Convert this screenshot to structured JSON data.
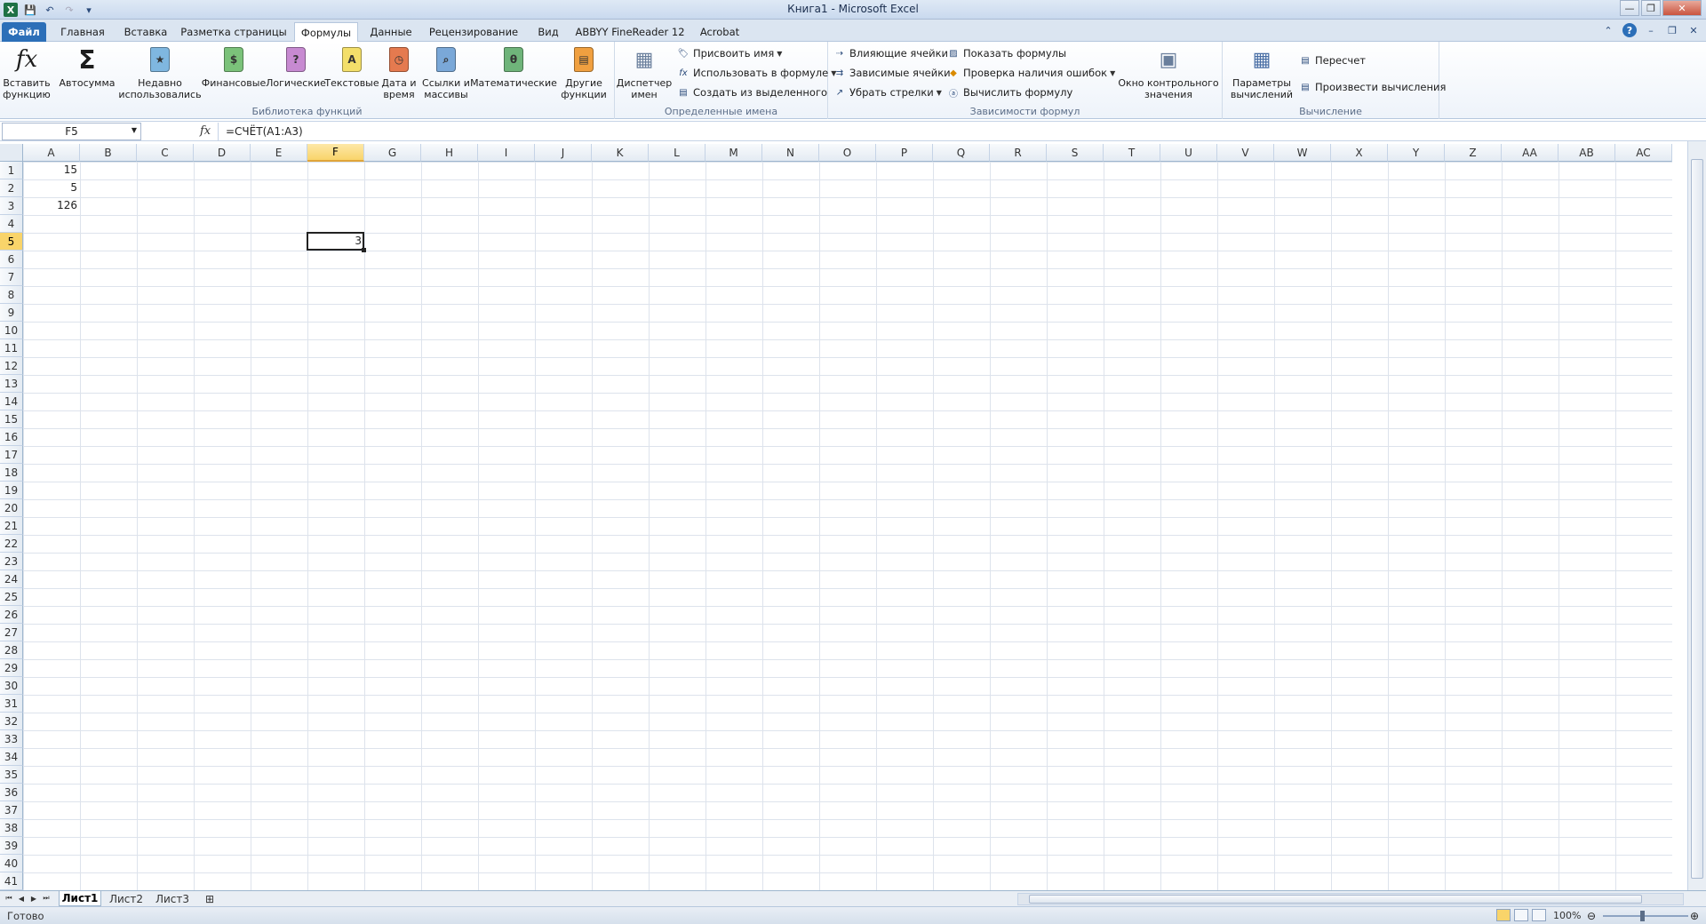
{
  "window": {
    "title": "Книга1  -  Microsoft Excel",
    "qat_sep": "|",
    "controls": [
      "—",
      "❐",
      "✕"
    ]
  },
  "tabs": [
    {
      "label": "Файл",
      "kind": "file"
    },
    {
      "label": "Главная"
    },
    {
      "label": "Вставка"
    },
    {
      "label": "Разметка страницы"
    },
    {
      "label": "Формулы",
      "active": true
    },
    {
      "label": "Данные"
    },
    {
      "label": "Рецензирование"
    },
    {
      "label": "Вид"
    },
    {
      "label": "ABBYY FineReader 12"
    },
    {
      "label": "Acrobat"
    }
  ],
  "ribbon": {
    "library": {
      "label": "Библиотека функций",
      "insert_function": "Вставить функцию",
      "autosum": "Автосумма",
      "recent": "Недавно использовались",
      "financial": "Финансовые",
      "logical": "Логические",
      "text": "Текстовые",
      "datetime": "Дата и время",
      "lookup": "Ссылки и массивы",
      "math": "Математические",
      "other": "Другие функции"
    },
    "names": {
      "label": "Определенные имена",
      "manager": "Диспетчер имен",
      "define": "Присвоить имя",
      "use_in_formula": "Использовать в формуле",
      "create_from_selection": "Создать из выделенного"
    },
    "auditing": {
      "label": "Зависимости формул",
      "trace_precedents": "Влияющие ячейки",
      "trace_dependents": "Зависимые ячейки",
      "remove_arrows": "Убрать стрелки",
      "show_formulas": "Показать формулы",
      "error_checking": "Проверка наличия ошибок",
      "evaluate": "Вычислить формулу",
      "watch_window": "Окно контрольного значения"
    },
    "calculation": {
      "label": "Вычисление",
      "options": "Параметры вычислений",
      "calc_now": "Пересчет",
      "calc_sheet": "Произвести вычисления"
    }
  },
  "formula_bar": {
    "name_box": "F5",
    "fx": "fx",
    "formula": "=СЧЁТ(A1:A3)"
  },
  "sheet": {
    "columns": [
      "A",
      "B",
      "C",
      "D",
      "E",
      "F",
      "G",
      "H",
      "I",
      "J",
      "K",
      "L",
      "M",
      "N",
      "O",
      "P",
      "Q",
      "R",
      "S",
      "T",
      "U",
      "V",
      "W",
      "X",
      "Y",
      "Z",
      "AA",
      "AB",
      "AC"
    ],
    "row_count": 41,
    "selected_col": "F",
    "selected_row": 5,
    "cells": [
      {
        "ref": "A1",
        "value": "15"
      },
      {
        "ref": "A2",
        "value": "5"
      },
      {
        "ref": "A3",
        "value": "126"
      },
      {
        "ref": "F5",
        "value": "3"
      }
    ]
  },
  "sheet_tabs": [
    {
      "label": "Лист1",
      "active": true
    },
    {
      "label": "Лист2"
    },
    {
      "label": "Лист3"
    }
  ],
  "status": {
    "text": "Готово",
    "zoom": "100%"
  }
}
